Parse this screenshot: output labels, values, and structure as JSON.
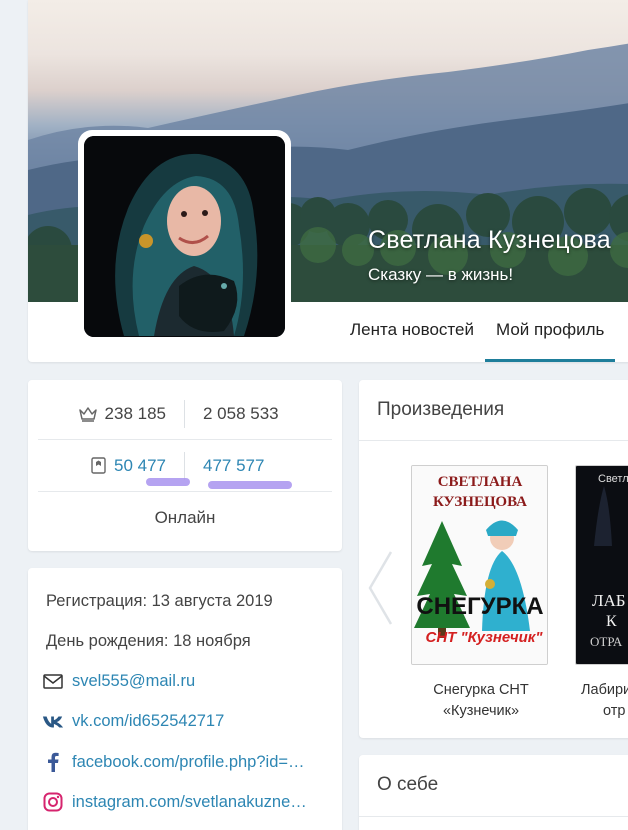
{
  "profile": {
    "name": "Светлана Кузнецова",
    "status": "Сказку — в жизнь!"
  },
  "tabs": [
    {
      "label": "Лента новостей",
      "active": false
    },
    {
      "label": "Мой профиль",
      "active": true
    }
  ],
  "stats": {
    "crown_value": "238 185",
    "second_value": "2 058 533",
    "books_value": "50 477",
    "fourth_value": "477 577",
    "online_label": "Онлайн",
    "underline_color": "#a893ee"
  },
  "info": {
    "registration": "Регистрация: 13 августа 2019",
    "birthday": "День рождения: 18 ноября",
    "email": "svel555@mail.ru",
    "vk": "vk.com/id652542717",
    "facebook": "facebook.com/profile.php?id=…",
    "instagram": "instagram.com/svetlanakuzne…"
  },
  "works": {
    "title": "Произведения",
    "books": [
      {
        "title_line1": "Снегурка СНТ",
        "title_line2": "«Кузнечик»",
        "cover_author_line1": "СВЕТЛАНА",
        "cover_author_line2": "КУЗНЕЦОВА",
        "cover_title": "СНЕГУРКА",
        "cover_subtitle": "СНТ \"Кузнечик\""
      },
      {
        "title_line1": "Лабиринт",
        "title_line2": "отр",
        "cover_author": "Светла",
        "cover_title": "ЛАБ",
        "cover_line2": "К",
        "cover_line3": "ОТРА"
      }
    ]
  },
  "about": {
    "title": "О себе"
  },
  "colors": {
    "accent": "#1e7e9b",
    "link": "#2d86b3",
    "background": "#edf1f5"
  }
}
